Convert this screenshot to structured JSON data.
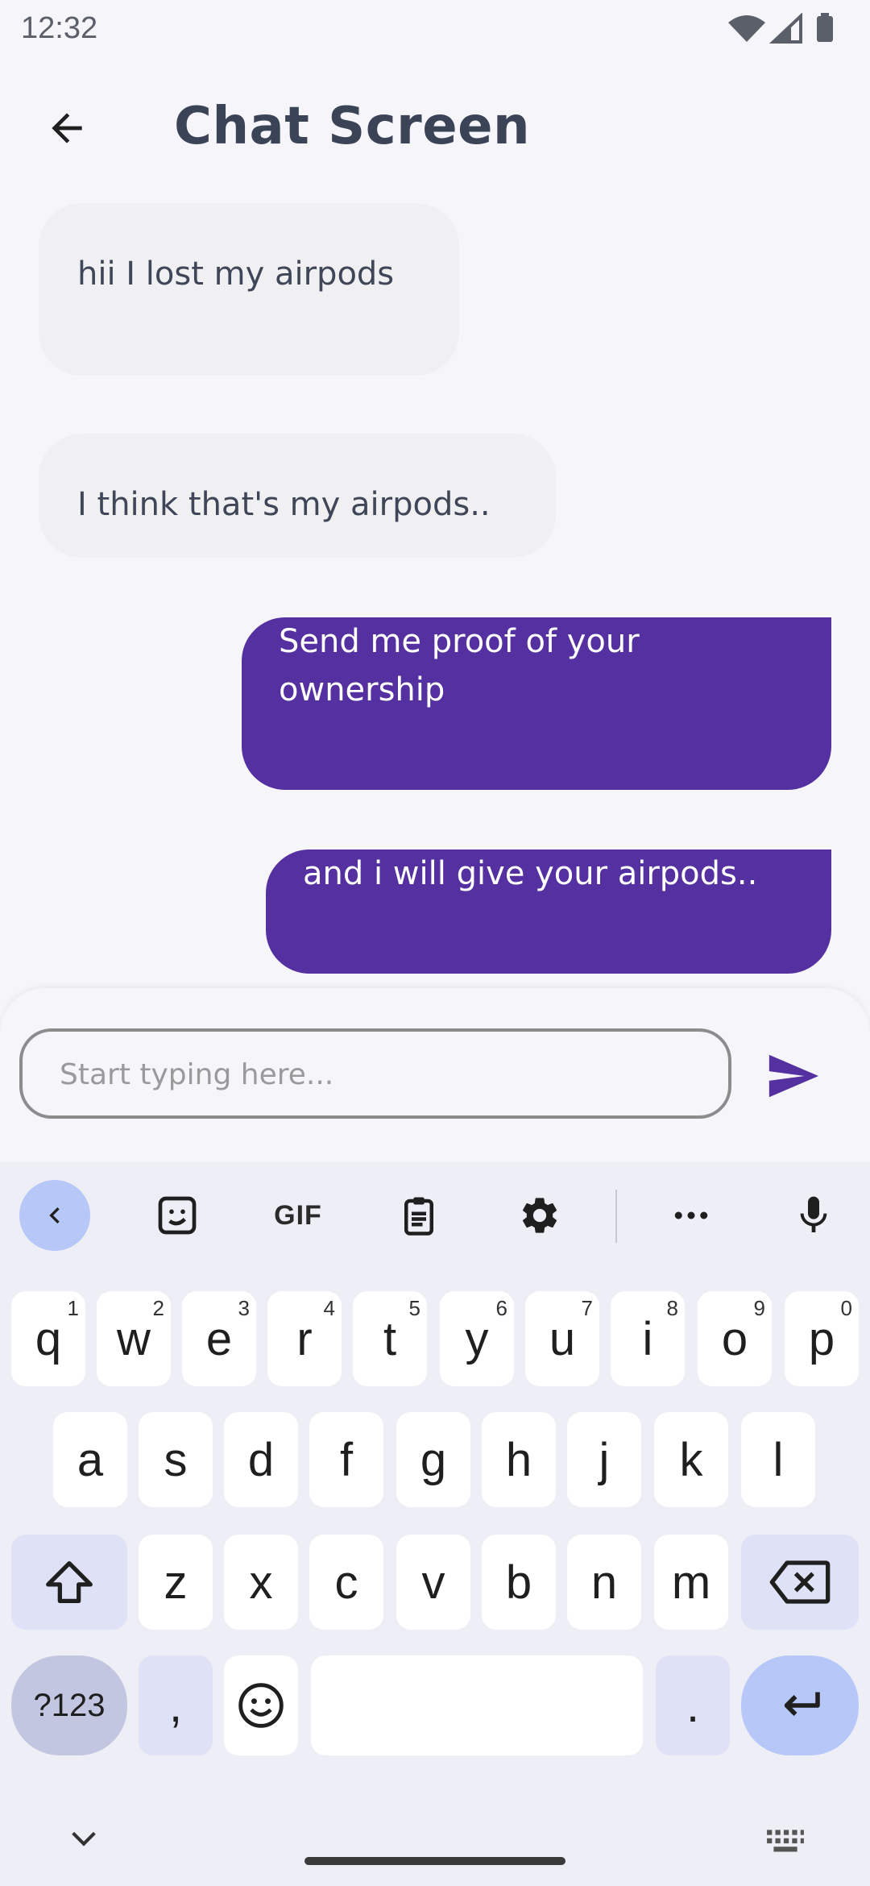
{
  "status": {
    "time": "12:32"
  },
  "appbar": {
    "title": "Chat Screen"
  },
  "messages": [
    {
      "text": "hii I lost my airpods",
      "direction": "incoming"
    },
    {
      "text": "I think that's my airpods..",
      "direction": "incoming"
    },
    {
      "text": "Send me proof of your ownership",
      "direction": "outgoing"
    },
    {
      "text": "and i will give your airpods..",
      "direction": "outgoing"
    }
  ],
  "composer": {
    "placeholder": "Start typing here...",
    "value": ""
  },
  "keyboard": {
    "toolbar": {
      "gif_label": "GIF"
    },
    "row1": [
      {
        "k": "q",
        "h": "1"
      },
      {
        "k": "w",
        "h": "2"
      },
      {
        "k": "e",
        "h": "3"
      },
      {
        "k": "r",
        "h": "4"
      },
      {
        "k": "t",
        "h": "5"
      },
      {
        "k": "y",
        "h": "6"
      },
      {
        "k": "u",
        "h": "7"
      },
      {
        "k": "i",
        "h": "8"
      },
      {
        "k": "o",
        "h": "9"
      },
      {
        "k": "p",
        "h": "0"
      }
    ],
    "row2": [
      "a",
      "s",
      "d",
      "f",
      "g",
      "h",
      "j",
      "k",
      "l"
    ],
    "row3": [
      "z",
      "x",
      "c",
      "v",
      "b",
      "n",
      "m"
    ],
    "row4": {
      "sym": "?123",
      "comma": ",",
      "period": "."
    }
  },
  "colors": {
    "accent": "#5430a0",
    "incoming_bubble": "#f0f0f3",
    "keyboard_accent": "#b6c7f8"
  }
}
